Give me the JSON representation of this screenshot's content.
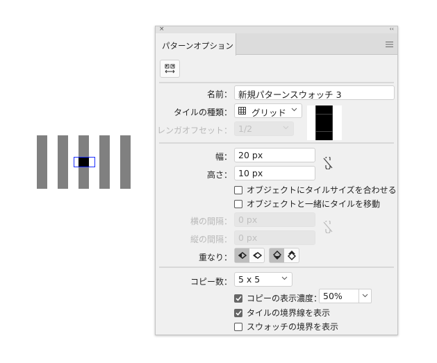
{
  "panel": {
    "title": "パターンオプション",
    "close_icon": "×",
    "collapse_icon": "‹‹"
  },
  "name": {
    "label": "名前：",
    "value": "新規パターンスウォッチ 3"
  },
  "tile_type": {
    "label": "タイルの種類：",
    "value": "グリッド"
  },
  "brick_offset": {
    "label": "レンガオフセット：",
    "value": "1/2"
  },
  "width": {
    "label": "幅：",
    "value": "20 px"
  },
  "height": {
    "label": "高さ：",
    "value": "10 px"
  },
  "fit_tile": {
    "label": "オブジェクトにタイルサイズを合わせる",
    "checked": false
  },
  "move_tile": {
    "label": "オブジェクトと一緒にタイルを移動",
    "checked": false
  },
  "h_spacing": {
    "label": "横の間隔：",
    "value": "0 px"
  },
  "v_spacing": {
    "label": "縦の間隔：",
    "value": "0 px"
  },
  "overlap": {
    "label": "重なり："
  },
  "copies": {
    "label": "コピー数：",
    "value": "5 x 5"
  },
  "dim_copies": {
    "label": "コピーの表示濃度：",
    "checked": true,
    "value": "50%"
  },
  "show_tile_edge": {
    "label": "タイルの境界線を表示",
    "checked": true
  },
  "show_swatch_bounds": {
    "label": "スウォッチの境界を表示",
    "checked": false
  }
}
